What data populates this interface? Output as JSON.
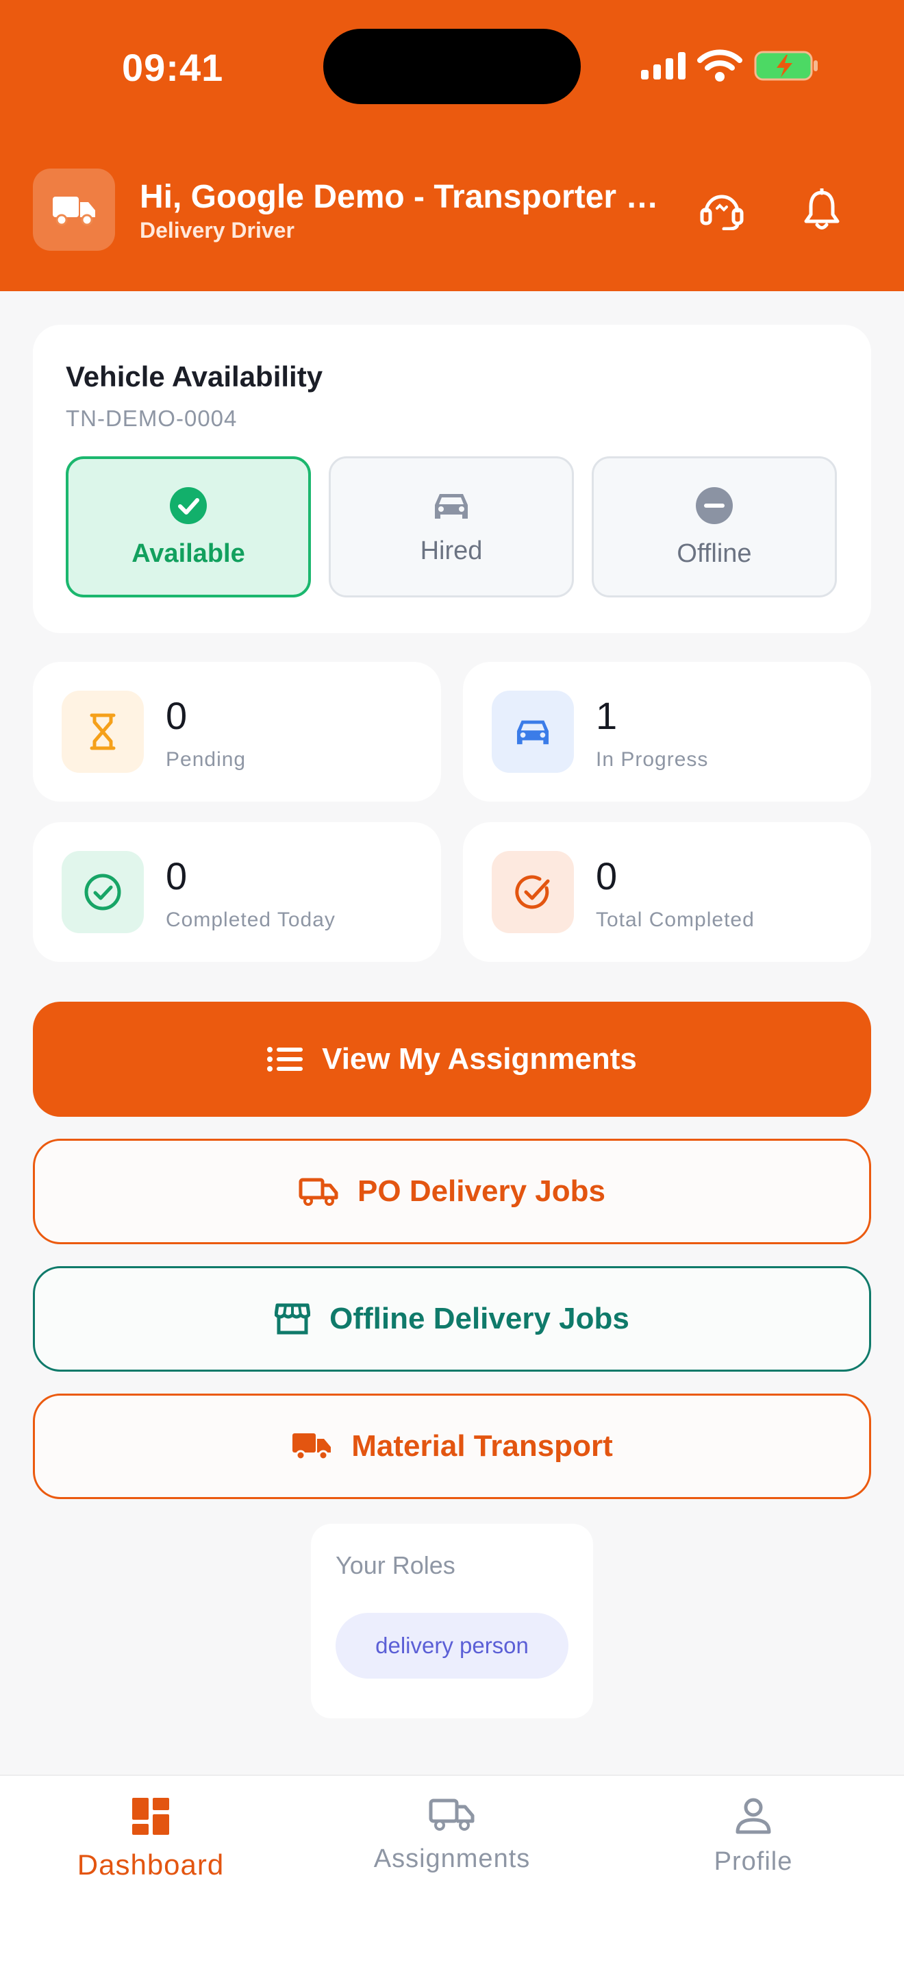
{
  "status_bar": {
    "time": "09:41"
  },
  "header": {
    "greeting": "Hi, Google Demo - Transporter Name",
    "role": "Delivery Driver",
    "icons": {
      "avatar": "truck-icon",
      "support": "headset-icon",
      "notifications": "bell-icon"
    }
  },
  "availability": {
    "title": "Vehicle Availability",
    "vehicle_id": "TN-DEMO-0004",
    "selected": "Available",
    "options": [
      {
        "label": "Available",
        "icon": "check-circle-icon"
      },
      {
        "label": "Hired",
        "icon": "car-icon"
      },
      {
        "label": "Offline",
        "icon": "minus-circle-icon"
      }
    ]
  },
  "stats": [
    {
      "value": "0",
      "label": "Pending",
      "icon": "hourglass-icon",
      "color": "#f5a01a",
      "bg": "#fff3e3"
    },
    {
      "value": "1",
      "label": "In Progress",
      "icon": "car-icon",
      "color": "#3b7ce8",
      "bg": "#e7effd"
    },
    {
      "value": "0",
      "label": "Completed Today",
      "icon": "check-circle-icon",
      "color": "#17a566",
      "bg": "#e1f6ec"
    },
    {
      "value": "0",
      "label": "Total Completed",
      "icon": "check-badge-icon",
      "color": "#e35510",
      "bg": "#fde9df"
    }
  ],
  "actions": {
    "view_assignments": "View My Assignments",
    "po_delivery": "PO Delivery Jobs",
    "offline_delivery": "Offline Delivery Jobs",
    "material_transport": "Material Transport"
  },
  "roles": {
    "title": "Your Roles",
    "items": [
      "delivery person"
    ]
  },
  "nav": {
    "active": "Dashboard",
    "items": [
      {
        "label": "Dashboard",
        "icon": "dashboard-icon"
      },
      {
        "label": "Assignments",
        "icon": "truck-icon"
      },
      {
        "label": "Profile",
        "icon": "user-icon"
      }
    ]
  },
  "colors": {
    "brand": "#eb5a0f",
    "teal": "#0f7a6a",
    "success": "#1bb76e"
  }
}
